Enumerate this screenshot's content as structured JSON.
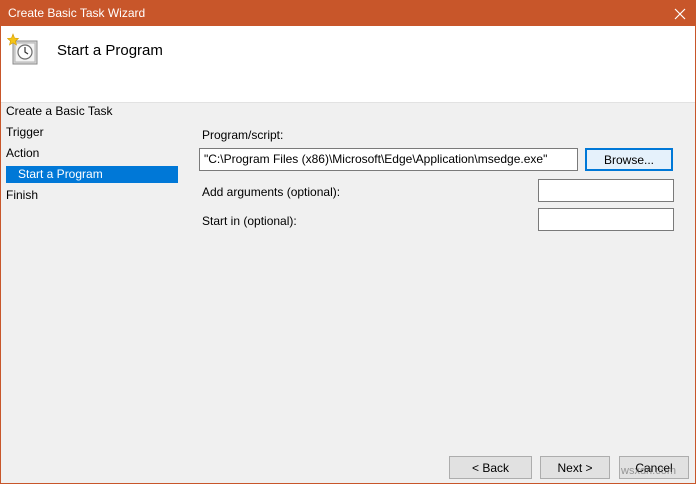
{
  "window": {
    "title": "Create Basic Task Wizard"
  },
  "header": {
    "title": "Start a Program",
    "icon": "task-clock-icon"
  },
  "steps": [
    {
      "label": "Create a Basic Task"
    },
    {
      "label": "Trigger"
    },
    {
      "label": "Action"
    },
    {
      "label": "Start a Program"
    },
    {
      "label": "Finish"
    }
  ],
  "form": {
    "program_label": "Program/script:",
    "program_value": "\"C:\\Program Files (x86)\\Microsoft\\Edge\\Application\\msedge.exe\"",
    "browse_label": "Browse...",
    "arguments_label": "Add arguments (optional):",
    "arguments_value": "",
    "start_in_label": "Start in (optional):",
    "start_in_value": ""
  },
  "footer": {
    "back_label": "< Back",
    "next_label": "Next >",
    "cancel_label": "Cancel"
  },
  "watermark": "wsxdn.com",
  "colors": {
    "titlebar": "#c8562a",
    "selection": "#0078d7",
    "background": "#f0f0f0"
  }
}
